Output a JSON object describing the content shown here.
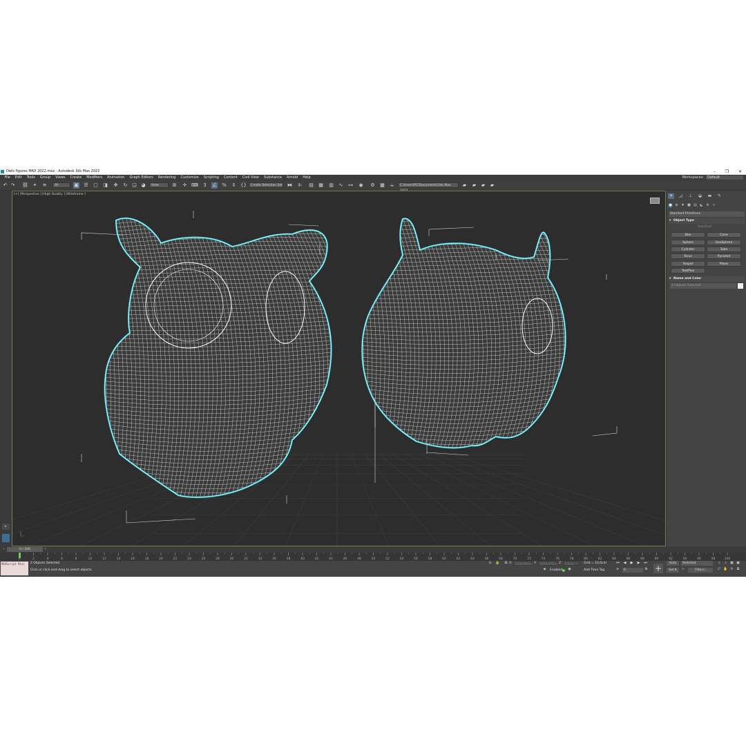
{
  "window": {
    "title": "Owls figures MAX 2022.max - Autodesk 3ds Max 2022",
    "controls": [
      "–",
      "❐",
      "✕"
    ]
  },
  "menu": {
    "items": [
      "File",
      "Edit",
      "Tools",
      "Group",
      "Views",
      "Create",
      "Modifiers",
      "Animation",
      "Graph Editors",
      "Rendering",
      "Customize",
      "Scripting",
      "Content",
      "Civil View",
      "Substance",
      "Arnold",
      "Help"
    ],
    "workspaces_label": "Workspaces:",
    "workspace_value": "Default"
  },
  "toolbar": {
    "filter_value": "All",
    "view_value": "View",
    "selection_set_placeholder": "Create Selection Set",
    "project_path": "C:\\Users\\PC\\Documents\\3ds Max 2022"
  },
  "viewport": {
    "label": "[+] [Perspective ] [High Quality ] [Wireframe ]",
    "wire_color": "#ffffff",
    "selection_color": "#39d0e0",
    "bbox_color": "#d8d8d8",
    "grid_color": "#3d3d3d"
  },
  "command_panel": {
    "category": "Standard Primitives",
    "object_type_title": "Object Type",
    "autogrid_label": "AutoGrid",
    "buttons": [
      "Box",
      "Cone",
      "Sphere",
      "GeoSphere",
      "Cylinder",
      "Tube",
      "Torus",
      "Pyramid",
      "Teapot",
      "Plane",
      "TextPlus"
    ],
    "name_color_title": "Name and Color",
    "name_value": "2 Objects Selected"
  },
  "timeline": {
    "frame_counter": "0 / 100",
    "ticks": [
      "0",
      "2",
      "4",
      "6",
      "8",
      "10",
      "12",
      "14",
      "16",
      "18",
      "20",
      "22",
      "24",
      "26",
      "28",
      "30",
      "32",
      "34",
      "36",
      "38",
      "40",
      "42",
      "44",
      "46",
      "48",
      "50",
      "52",
      "54",
      "56",
      "58",
      "60",
      "62",
      "64",
      "66",
      "68",
      "70",
      "72",
      "74",
      "76",
      "78",
      "80",
      "82",
      "84",
      "86",
      "88",
      "90",
      "92",
      "94",
      "96",
      "98",
      "100"
    ]
  },
  "status": {
    "maxscript_label": "MAXScript Mini",
    "selection_text": "2 Objects Selected",
    "prompt_text": "Click or click-and-drag to select objects",
    "x_label": "X:",
    "x_value": "2370,993cm",
    "y_label": "Y:",
    "y_value": "1259,979cm",
    "z_label": "Z:",
    "z_value": "0,0cm",
    "grid_text": "Grid = 10,0cm",
    "enabled_label": "Enabled:",
    "add_time_tag": "Add Time Tag",
    "auto_label": "Auto",
    "set_key_label": "Set K",
    "key_mode_value": "Selected",
    "filters_label": "Filters...",
    "current_frame": "0"
  }
}
